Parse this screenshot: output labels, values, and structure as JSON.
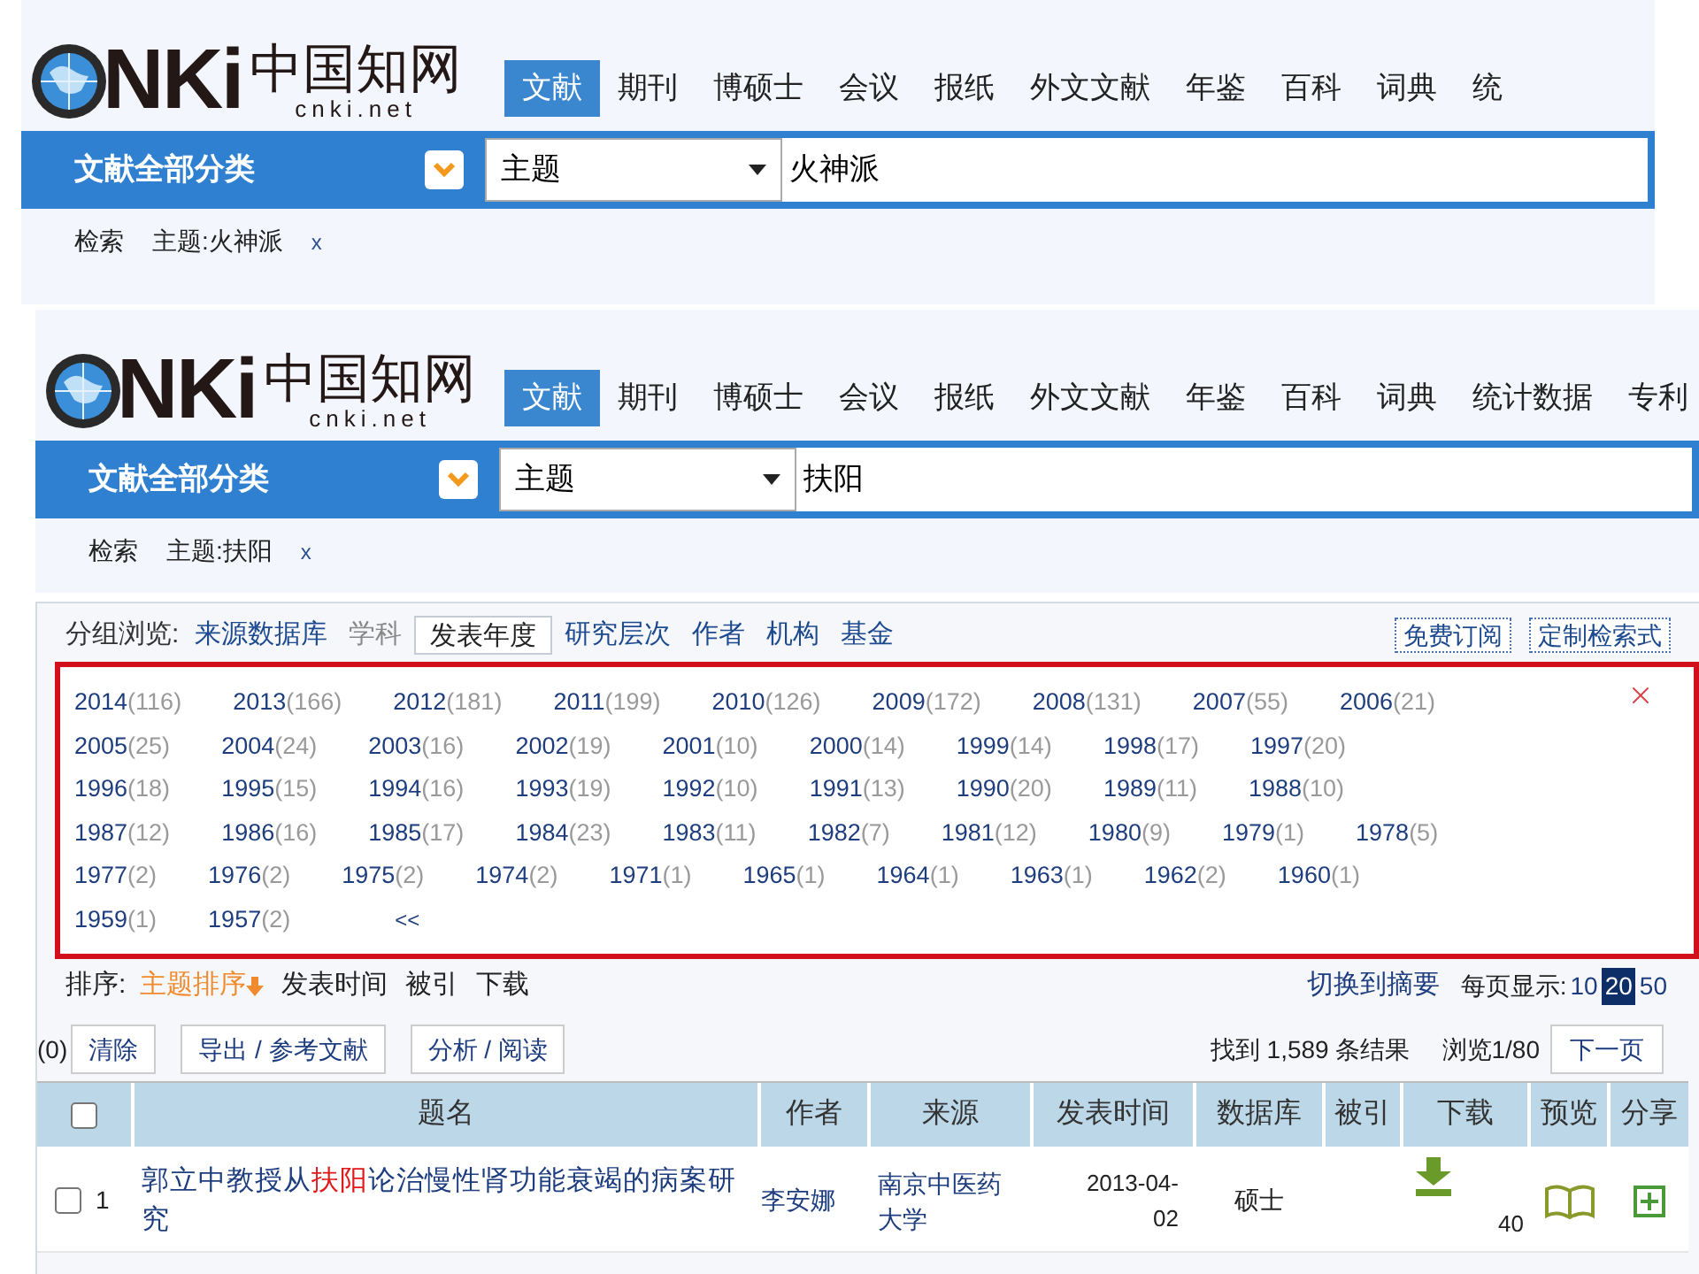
{
  "screens": [
    {
      "logo": {
        "mark": "NKi",
        "name": "中国知网",
        "url": "cnki.net"
      },
      "nav_tabs": [
        {
          "label": "文献",
          "selected": true
        },
        {
          "label": "期刊",
          "selected": false
        },
        {
          "label": "博硕士",
          "selected": false
        },
        {
          "label": "会议",
          "selected": false
        },
        {
          "label": "报纸",
          "selected": false
        },
        {
          "label": "外文文献",
          "selected": false
        },
        {
          "label": "年鉴",
          "selected": false
        },
        {
          "label": "百科",
          "selected": false
        },
        {
          "label": "词典",
          "selected": false
        },
        {
          "label": "统",
          "selected": false
        }
      ],
      "category_button": "文献全部分类",
      "search": {
        "field": "主题",
        "value": "火神派"
      },
      "breadcrumb": {
        "label": "检索",
        "term": "主题:火神派",
        "remove": "x"
      }
    },
    {
      "logo": {
        "mark": "NKi",
        "name": "中国知网",
        "url": "cnki.net"
      },
      "nav_tabs": [
        {
          "label": "文献",
          "selected": true
        },
        {
          "label": "期刊",
          "selected": false
        },
        {
          "label": "博硕士",
          "selected": false
        },
        {
          "label": "会议",
          "selected": false
        },
        {
          "label": "报纸",
          "selected": false
        },
        {
          "label": "外文文献",
          "selected": false
        },
        {
          "label": "年鉴",
          "selected": false
        },
        {
          "label": "百科",
          "selected": false
        },
        {
          "label": "词典",
          "selected": false
        },
        {
          "label": "统计数据",
          "selected": false
        },
        {
          "label": "专利",
          "selected": false
        }
      ],
      "category_button": "文献全部分类",
      "search": {
        "field": "主题",
        "value": "扶阳"
      },
      "breadcrumb": {
        "label": "检索",
        "term": "主题:扶阳",
        "remove": "x"
      }
    }
  ],
  "results": {
    "group_browse": {
      "label": "分组浏览:",
      "tabs": [
        {
          "label": "来源数据库",
          "selected": false,
          "disabled": false
        },
        {
          "label": "学科",
          "selected": false,
          "disabled": true
        },
        {
          "label": "发表年度",
          "selected": true,
          "disabled": false
        },
        {
          "label": "研究层次",
          "selected": false,
          "disabled": false
        },
        {
          "label": "作者",
          "selected": false,
          "disabled": false
        },
        {
          "label": "机构",
          "selected": false,
          "disabled": false
        },
        {
          "label": "基金",
          "selected": false,
          "disabled": false
        }
      ],
      "buttons": [
        "免费订阅",
        "定制检索式"
      ]
    },
    "year_filter": {
      "rows": [
        [
          {
            "year": "2014",
            "count": "(116)"
          },
          {
            "year": "2013",
            "count": "(166)"
          },
          {
            "year": "2012",
            "count": "(181)"
          },
          {
            "year": "2011",
            "count": "(199)"
          },
          {
            "year": "2010",
            "count": "(126)"
          },
          {
            "year": "2009",
            "count": "(172)"
          },
          {
            "year": "2008",
            "count": "(131)"
          },
          {
            "year": "2007",
            "count": "(55)"
          },
          {
            "year": "2006",
            "count": "(21)"
          }
        ],
        [
          {
            "year": "2005",
            "count": "(25)"
          },
          {
            "year": "2004",
            "count": "(24)"
          },
          {
            "year": "2003",
            "count": "(16)"
          },
          {
            "year": "2002",
            "count": "(19)"
          },
          {
            "year": "2001",
            "count": "(10)"
          },
          {
            "year": "2000",
            "count": "(14)"
          },
          {
            "year": "1999",
            "count": "(14)"
          },
          {
            "year": "1998",
            "count": "(17)"
          },
          {
            "year": "1997",
            "count": "(20)"
          }
        ],
        [
          {
            "year": "1996",
            "count": "(18)"
          },
          {
            "year": "1995",
            "count": "(15)"
          },
          {
            "year": "1994",
            "count": "(16)"
          },
          {
            "year": "1993",
            "count": "(19)"
          },
          {
            "year": "1992",
            "count": "(10)"
          },
          {
            "year": "1991",
            "count": "(13)"
          },
          {
            "year": "1990",
            "count": "(20)"
          },
          {
            "year": "1989",
            "count": "(11)"
          },
          {
            "year": "1988",
            "count": "(10)"
          }
        ],
        [
          {
            "year": "1987",
            "count": "(12)"
          },
          {
            "year": "1986",
            "count": "(16)"
          },
          {
            "year": "1985",
            "count": "(17)"
          },
          {
            "year": "1984",
            "count": "(23)"
          },
          {
            "year": "1983",
            "count": "(11)"
          },
          {
            "year": "1982",
            "count": "(7)"
          },
          {
            "year": "1981",
            "count": "(12)"
          },
          {
            "year": "1980",
            "count": "(9)"
          },
          {
            "year": "1979",
            "count": "(1)"
          },
          {
            "year": "1978",
            "count": "(5)"
          }
        ],
        [
          {
            "year": "1977",
            "count": "(2)"
          },
          {
            "year": "1976",
            "count": "(2)"
          },
          {
            "year": "1975",
            "count": "(2)"
          },
          {
            "year": "1974",
            "count": "(2)"
          },
          {
            "year": "1971",
            "count": "(1)"
          },
          {
            "year": "1965",
            "count": "(1)"
          },
          {
            "year": "1964",
            "count": "(1)"
          },
          {
            "year": "1963",
            "count": "(1)"
          },
          {
            "year": "1962",
            "count": "(2)"
          },
          {
            "year": "1960",
            "count": "(1)"
          }
        ],
        [
          {
            "year": "1959",
            "count": "(1)"
          },
          {
            "year": "1957",
            "count": "(2)"
          }
        ]
      ],
      "collapse": "<<"
    },
    "sort": {
      "label": "排序:",
      "options": [
        {
          "label": "主题排序",
          "selected": true
        },
        {
          "label": "发表时间",
          "selected": false
        },
        {
          "label": "被引",
          "selected": false
        },
        {
          "label": "下载",
          "selected": false
        }
      ]
    },
    "view_toggle": "切换到摘要",
    "page_size": {
      "label": "每页显示:",
      "options": [
        {
          "label": "10",
          "selected": false
        },
        {
          "label": "20",
          "selected": true
        },
        {
          "label": "50",
          "selected": false
        }
      ]
    },
    "selected_count": "(0)",
    "actions": [
      "清除",
      "导出 / 参考文献",
      "分析 / 阅读"
    ],
    "found": "找到 1,589 条结果",
    "pager": "浏览1/80",
    "next_page": "下一页",
    "table": {
      "header_checked": false,
      "columns": [
        "题名",
        "作者",
        "来源",
        "发表时间",
        "数据库",
        "被引",
        "下载",
        "预览",
        "分享"
      ],
      "rows": [
        {
          "checked": false,
          "index": "1",
          "title": [
            {
              "text": "郭立中教授从",
              "highlight": false
            },
            {
              "text": "扶阳",
              "highlight": true
            },
            {
              "text": "论治慢性肾功能衰竭的病案研究",
              "highlight": false
            }
          ],
          "author": "李安娜",
          "source": "南京中医药大学",
          "date": "2013-04-02",
          "database": "硕士",
          "downloads": "40"
        }
      ]
    }
  }
}
